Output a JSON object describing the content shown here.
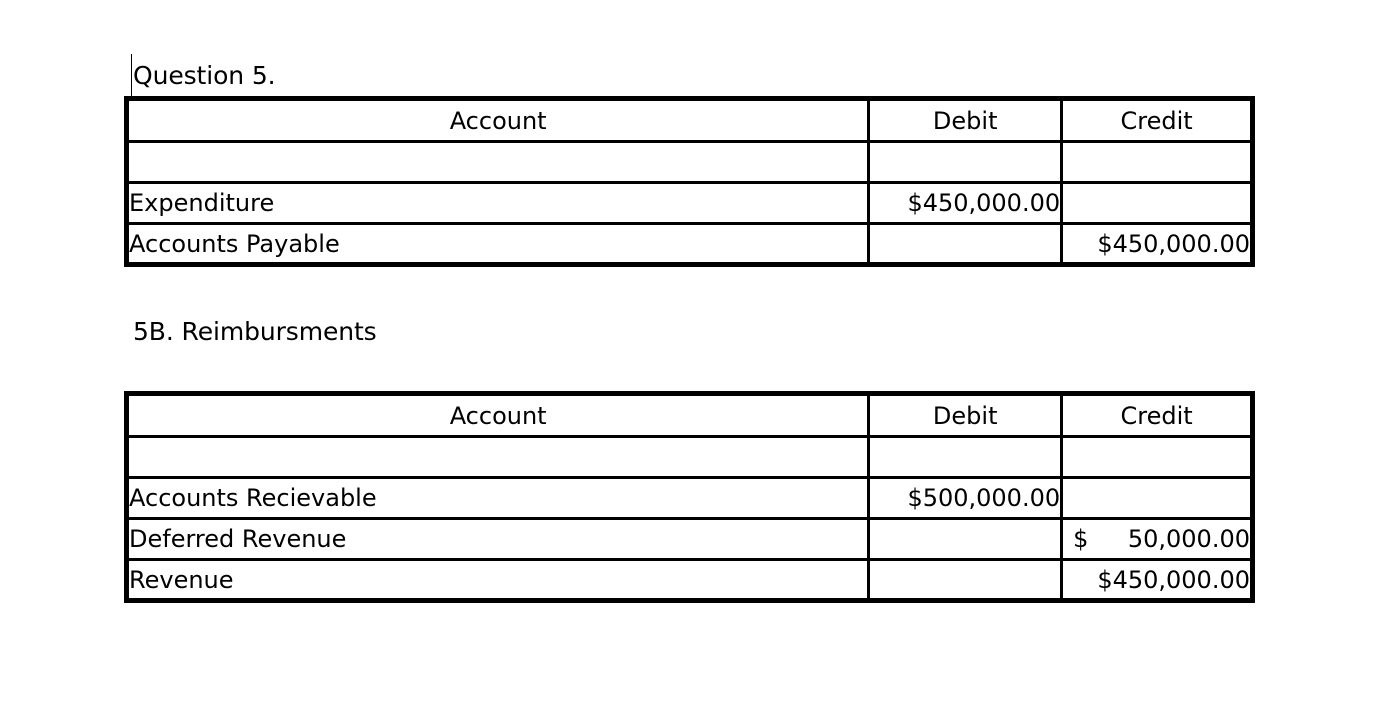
{
  "document": {
    "background_color": "#ffffff",
    "text_color": "#000000",
    "border_color": "#000000"
  },
  "headings": {
    "question": "Question 5.",
    "part_b": "5B. Reimbursments"
  },
  "caret": {
    "name": "text-cursor"
  },
  "tables": [
    {
      "id": "table-1",
      "columns": [
        "Account",
        "Debit",
        "Credit"
      ],
      "rows": [
        {
          "account": "",
          "debit": "",
          "credit": ""
        },
        {
          "account": "Expenditure",
          "debit": "$450,000.00",
          "credit": ""
        },
        {
          "account": "Accounts Payable",
          "debit": "",
          "credit": "$450,000.00"
        }
      ]
    },
    {
      "id": "table-2",
      "columns": [
        "Account",
        "Debit",
        "Credit"
      ],
      "rows": [
        {
          "account": "",
          "debit": "",
          "credit": ""
        },
        {
          "account": "Accounts Recievable",
          "debit": "$500,000.00",
          "credit": ""
        },
        {
          "account": "Deferred Revenue",
          "debit": "",
          "credit_symbol": "$",
          "credit_number": "50,000.00"
        },
        {
          "account": "Revenue",
          "debit": "",
          "credit": "$450,000.00"
        }
      ]
    }
  ]
}
